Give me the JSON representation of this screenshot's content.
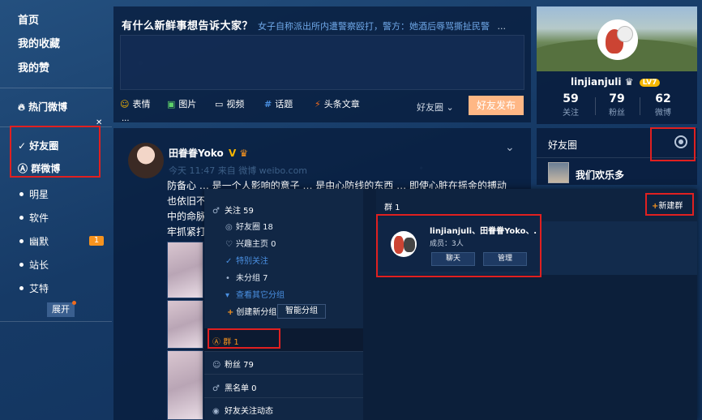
{
  "left_nav": {
    "main": [
      "首页",
      "我的收藏",
      "我的赞"
    ],
    "hot_weibo": "热门微博",
    "groups": [
      {
        "label": "好友圈",
        "icon": "check-icon",
        "active": true
      },
      {
        "label": "群微博",
        "icon": "at-icon",
        "active": true
      }
    ],
    "subs": [
      {
        "label": "明星"
      },
      {
        "label": "软件"
      },
      {
        "label": "幽默",
        "badge": "1"
      },
      {
        "label": "站长"
      },
      {
        "label": "艾特"
      }
    ],
    "expand": "展开",
    "pin_icon": "pin-icon"
  },
  "publisher": {
    "title": "有什么新鲜事想告诉大家？",
    "hot_topic": "女子自称派出所内遭警察殴打，警方：她酒后辱骂撕扯民警",
    "hot_more": "...",
    "tools": {
      "emoji": "表情",
      "image": "图片",
      "video": "视频",
      "topic": "话题",
      "article": "头条文章"
    },
    "visibility": "好友圈",
    "publish": "好友发布",
    "more": "···"
  },
  "profile": {
    "username": "linjianjuli",
    "level": "LV7",
    "stats": [
      {
        "num": "59",
        "label": "关注"
      },
      {
        "num": "79",
        "label": "粉丝"
      },
      {
        "num": "62",
        "label": "微博"
      }
    ]
  },
  "post": {
    "author": "田眷眷Yoko",
    "v": "V",
    "meta": "今天 11:47 来自 微博 weibo.com",
    "lines": [
      "防备心 … 是一个人影响的意子 … 是由心防线的东西 … 即使心脏在摇金的搏动",
      "也依旧不",
      "中的命脉",
      "牢抓紧打"
    ]
  },
  "groups_widget": {
    "title": "好友圈",
    "settings_icon": "settings-icon",
    "member_name": "我们欢乐多"
  },
  "popup": {
    "follow": "关注 59",
    "subs": [
      {
        "label": "好友圈 18",
        "icon": "circle-icon"
      },
      {
        "label": "兴趣主页 0",
        "icon": "heart-icon"
      },
      {
        "label": "特别关注",
        "icon": "check-icon",
        "blue": true
      },
      {
        "label": "未分组 7",
        "icon": "dot-icon"
      },
      {
        "label": "查看其它分组",
        "icon": "triangle-icon",
        "blue": true
      }
    ],
    "create_group": "创建新分组",
    "smart_group": "智能分组",
    "groups": "群 1",
    "fans": "粉丝 79",
    "blacklist": "黑名单 0",
    "friends_activity": "好友关注动态",
    "right_title": "群 1",
    "new_group": "新建群",
    "group": {
      "name": "linjianjuli、田眷眷Yoko、…",
      "members": "成员：3人",
      "chat": "聊天",
      "manage": "管理"
    }
  }
}
